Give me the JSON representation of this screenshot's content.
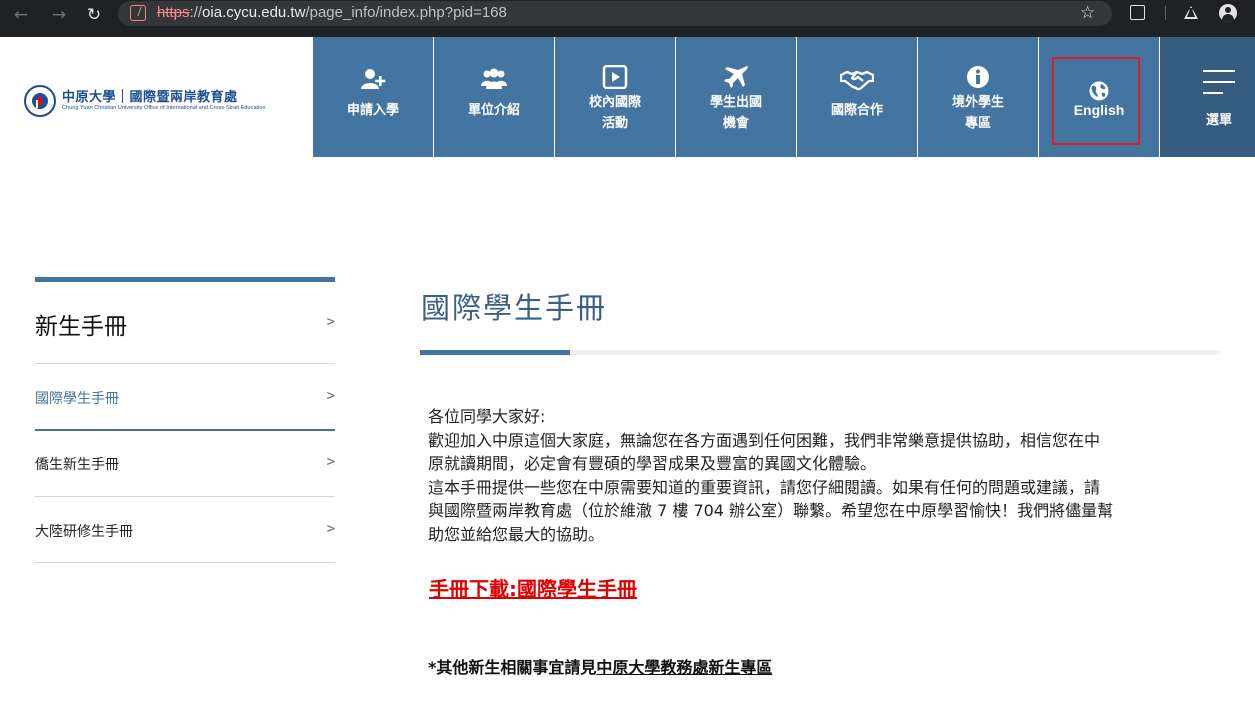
{
  "browser": {
    "url_scheme": "https",
    "url_sep": "://",
    "url_host": "oia.cycu.edu.tw",
    "url_path": "/page_info/index.php?pid=168"
  },
  "logo": {
    "name_zh": "中原大學｜國際暨兩岸教育處",
    "name_en": "Chung Yuan Christian University Office of International and Cross-Strait Education"
  },
  "menu": {
    "items": [
      {
        "label": "申請入學",
        "icon": "add-user-icon"
      },
      {
        "label": "單位介紹",
        "icon": "group-icon"
      },
      {
        "label": "校內國際",
        "sub": "活動",
        "icon": "play-icon"
      },
      {
        "label": "學生出國",
        "sub": "機會",
        "icon": "airplane-icon"
      },
      {
        "label": "國際合作",
        "icon": "handshake-icon"
      },
      {
        "label": "境外學生",
        "sub": "專區",
        "icon": "info-icon"
      },
      {
        "label": "English",
        "icon": "globe-icon"
      }
    ],
    "toggle_label": "選單"
  },
  "sidebar": {
    "title": "新生手冊",
    "chevron": ">",
    "items": [
      {
        "label": "國際學生手冊",
        "active": true
      },
      {
        "label": "僑生新生手冊",
        "active": false
      },
      {
        "label": "大陸研修生手冊",
        "active": false
      }
    ]
  },
  "main": {
    "title": "國際學生手冊",
    "lines": [
      "各位同學大家好:",
      "歡迎加入中原這個大家庭，無論您在各方面遇到任何困難，我們非常樂意提供協助，相信您在中",
      "原就讀期間，必定會有豐碩的學習成果及豐富的異國文化體驗。",
      "這本手冊提供一些您在中原需要知道的重要資訊，請您仔細閱讀。如果有任何的問題或建議，請",
      "與國際暨兩岸教育處（位於維澈 7 樓 704 辦公室）聯繫。希望您在中原學習愉快！我們將儘量幫",
      "助您並給您最大的協助。"
    ],
    "download_label": "手冊下載:國際學生手冊",
    "note_prefix": "*其他新生相關事宜請見",
    "note_link": "中原大學教務處新生專區"
  },
  "colors": {
    "menu_bg": "#4475a1",
    "menu_toggle_bg": "#365c80",
    "title_color": "#3a5f85",
    "download_color": "#e00000",
    "highlight_border": "#d91f26"
  }
}
